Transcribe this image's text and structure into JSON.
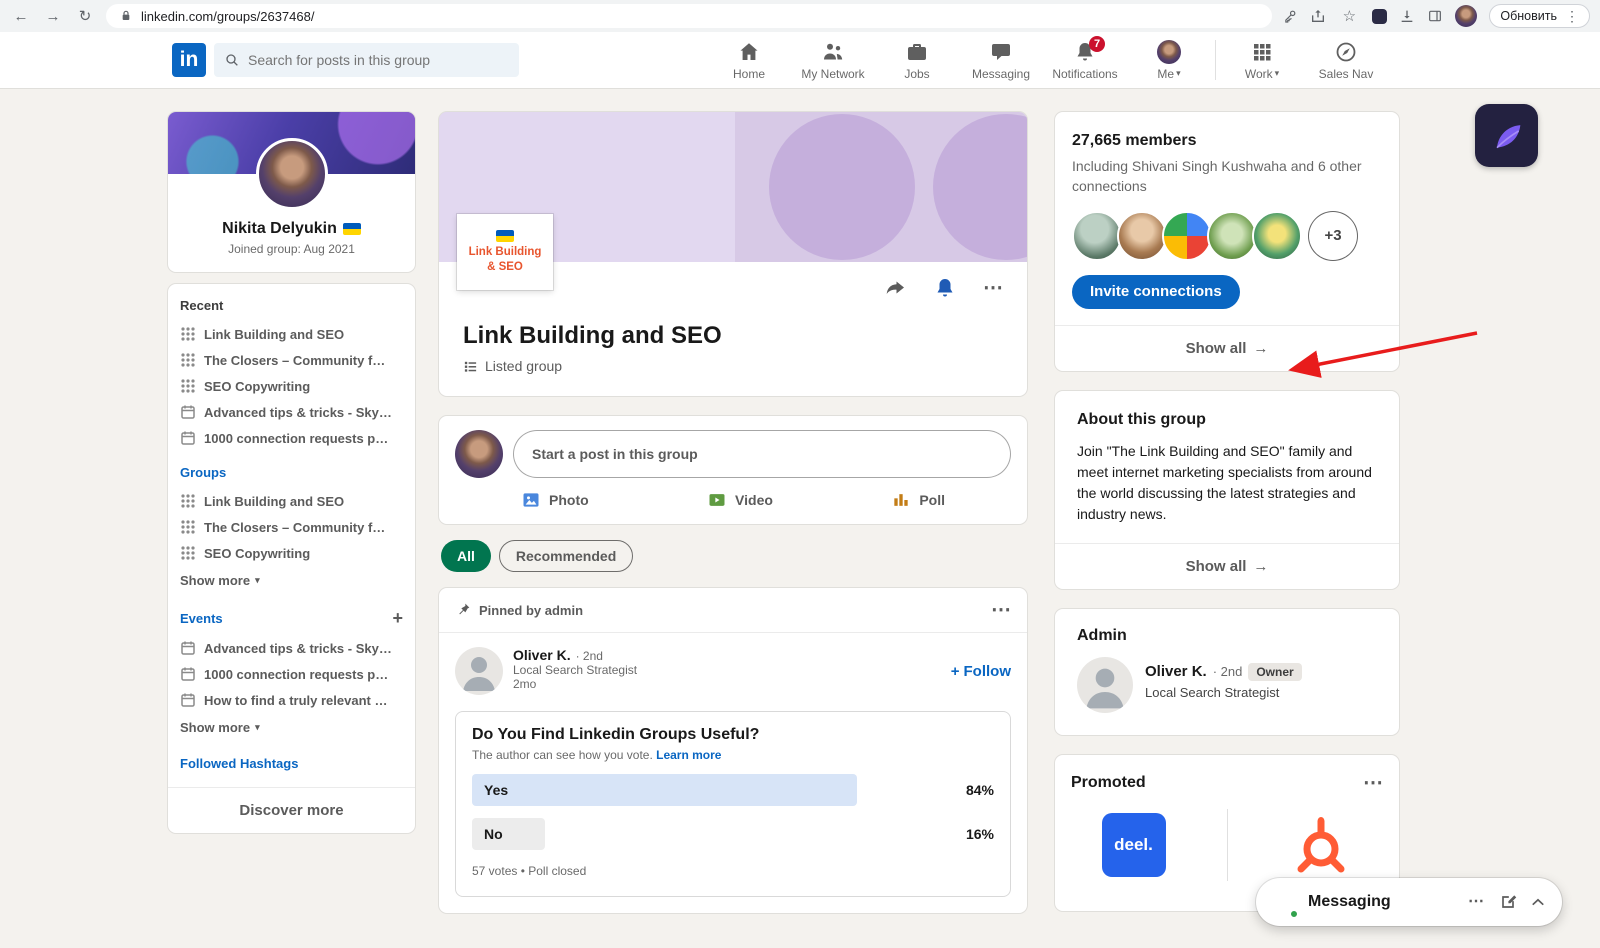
{
  "colors": {
    "accent_blue": "#0a66c2",
    "all_pill_green": "#01754f",
    "notification_red": "#cb112d",
    "annotation_arrow_red": "#e81c1c"
  },
  "browser": {
    "url": "linkedin.com/groups/2637468/",
    "update_button": "Обновить"
  },
  "nav": {
    "search_placeholder": "Search for posts in this group",
    "home": "Home",
    "my_network": "My Network",
    "jobs": "Jobs",
    "messaging": "Messaging",
    "notifications": "Notifications",
    "notification_count": "7",
    "me": "Me",
    "work": "Work",
    "sales_nav": "Sales Nav"
  },
  "profile_card": {
    "name": "Nikita Delyukin",
    "joined": "Joined group: Aug 2021"
  },
  "sidebar": {
    "recent_title": "Recent",
    "recent_items": [
      {
        "label": "Link Building and SEO"
      },
      {
        "label": "The Closers – Community f…"
      },
      {
        "label": "SEO Copywriting"
      },
      {
        "label": "Advanced tips & tricks - Sky…"
      },
      {
        "label": "1000 connection requests p…"
      }
    ],
    "groups_title": "Groups",
    "groups_items": [
      {
        "label": "Link Building and SEO"
      },
      {
        "label": "The Closers – Community f…"
      },
      {
        "label": "SEO Copywriting"
      }
    ],
    "groups_show_more": "Show more",
    "events_title": "Events",
    "events_items": [
      {
        "label": "Advanced tips & tricks - Sky…"
      },
      {
        "label": "1000 connection requests p…"
      },
      {
        "label": "How to find a truly relevant …"
      }
    ],
    "events_show_more": "Show more",
    "followed_hashtags": "Followed Hashtags",
    "discover_more": "Discover more"
  },
  "group": {
    "logo_line1": "Link Building",
    "logo_line2": "& SEO",
    "title": "Link Building and SEO",
    "listed": "Listed group"
  },
  "composer": {
    "placeholder": "Start a post in this group",
    "photo": "Photo",
    "video": "Video",
    "poll": "Poll"
  },
  "feed_filters": {
    "all": "All",
    "recommended": "Recommended"
  },
  "pinned_post": {
    "pinned_label": "Pinned by admin",
    "author": "Oliver K.",
    "degree": "· 2nd",
    "headline": "Local Search Strategist",
    "time": "2mo",
    "follow": "Follow",
    "poll": {
      "question": "Do You Find Linkedin Groups Useful?",
      "disclaimer": "The author can see how you vote.",
      "learn_more": "Learn more",
      "options": [
        {
          "label": "Yes",
          "pct_label": "84%",
          "pct": 84
        },
        {
          "label": "No",
          "pct_label": "16%",
          "pct": 16
        }
      ],
      "footer": "57 votes • Poll closed"
    }
  },
  "members": {
    "count": "27,665 members",
    "including": "Including Shivani Singh Kushwaha and 6 other connections",
    "overflow": "+3",
    "invite_button": "Invite connections",
    "show_all": "Show all"
  },
  "about": {
    "title": "About this group",
    "description": "Join \"The Link Building and SEO\" family and meet internet marketing specialists from around the world discussing the latest strategies and industry news.",
    "show_all": "Show all"
  },
  "admin": {
    "title": "Admin",
    "name": "Oliver K.",
    "degree": "· 2nd",
    "badge": "Owner",
    "headline": "Local Search Strategist"
  },
  "promoted": {
    "title": "Promoted",
    "deel_logo": "deel."
  },
  "messaging_panel": {
    "title": "Messaging"
  }
}
